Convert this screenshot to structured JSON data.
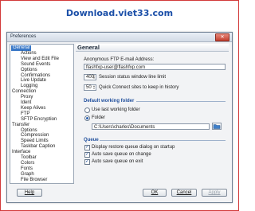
{
  "banner": {
    "text": "Download.viet33.com"
  },
  "window": {
    "title": "Preferences",
    "close_glyph": "✕"
  },
  "tree": {
    "items": [
      {
        "label": "General",
        "level": 0,
        "selected": true
      },
      {
        "label": "Actions",
        "level": 1
      },
      {
        "label": "View and Edit File",
        "level": 1
      },
      {
        "label": "Sound Events",
        "level": 1
      },
      {
        "label": "Options",
        "level": 1
      },
      {
        "label": "Confirmations",
        "level": 1
      },
      {
        "label": "Live Update",
        "level": 1
      },
      {
        "label": "Logging",
        "level": 1
      },
      {
        "label": "Connection",
        "level": 0
      },
      {
        "label": "Proxy",
        "level": 1
      },
      {
        "label": "Ident",
        "level": 1
      },
      {
        "label": "Keep Alives",
        "level": 1
      },
      {
        "label": "FTP",
        "level": 1
      },
      {
        "label": "SFTP Encryption",
        "level": 1
      },
      {
        "label": "Transfer",
        "level": 0
      },
      {
        "label": "Options",
        "level": 1
      },
      {
        "label": "Compression",
        "level": 1
      },
      {
        "label": "Speed Limits",
        "level": 1
      },
      {
        "label": "Taskbar Caption",
        "level": 1
      },
      {
        "label": "Interface",
        "level": 0
      },
      {
        "label": "Toolbar",
        "level": 1
      },
      {
        "label": "Colors",
        "level": 1
      },
      {
        "label": "Fonts",
        "level": 1
      },
      {
        "label": "Graph",
        "level": 1
      },
      {
        "label": "File Browser",
        "level": 1
      }
    ]
  },
  "panel": {
    "title": "General",
    "anon_label": "Anonymous FTP E-mail Address:",
    "anon_value": "flashfxp-user@flashfxp.com",
    "status_limit_value": "400",
    "status_limit_label": "Session status window line limit",
    "quick_connect_value": "50",
    "quick_connect_label": "Quick Connect sites to keep in history",
    "working_folder": {
      "title": "Default working folder",
      "option_last": "Use last working folder",
      "option_folder": "Folder",
      "folder_value": "C:\\Users\\charles\\Documents"
    },
    "queue": {
      "title": "Queue",
      "display_restore": "Display restore queue dialog on startup",
      "autosave_change": "Auto save queue on change",
      "autosave_exit": "Auto save queue on exit"
    }
  },
  "buttons": {
    "help": "Help",
    "ok": "OK",
    "cancel": "Cancel",
    "apply": "Apply"
  },
  "icons": {
    "folder": "folder-browse-icon",
    "close": "close-icon"
  },
  "colors": {
    "selection": "#3a78c7",
    "section_title": "#1f4e9c",
    "banner": "#1b4fa8",
    "close": "#c2402f"
  }
}
